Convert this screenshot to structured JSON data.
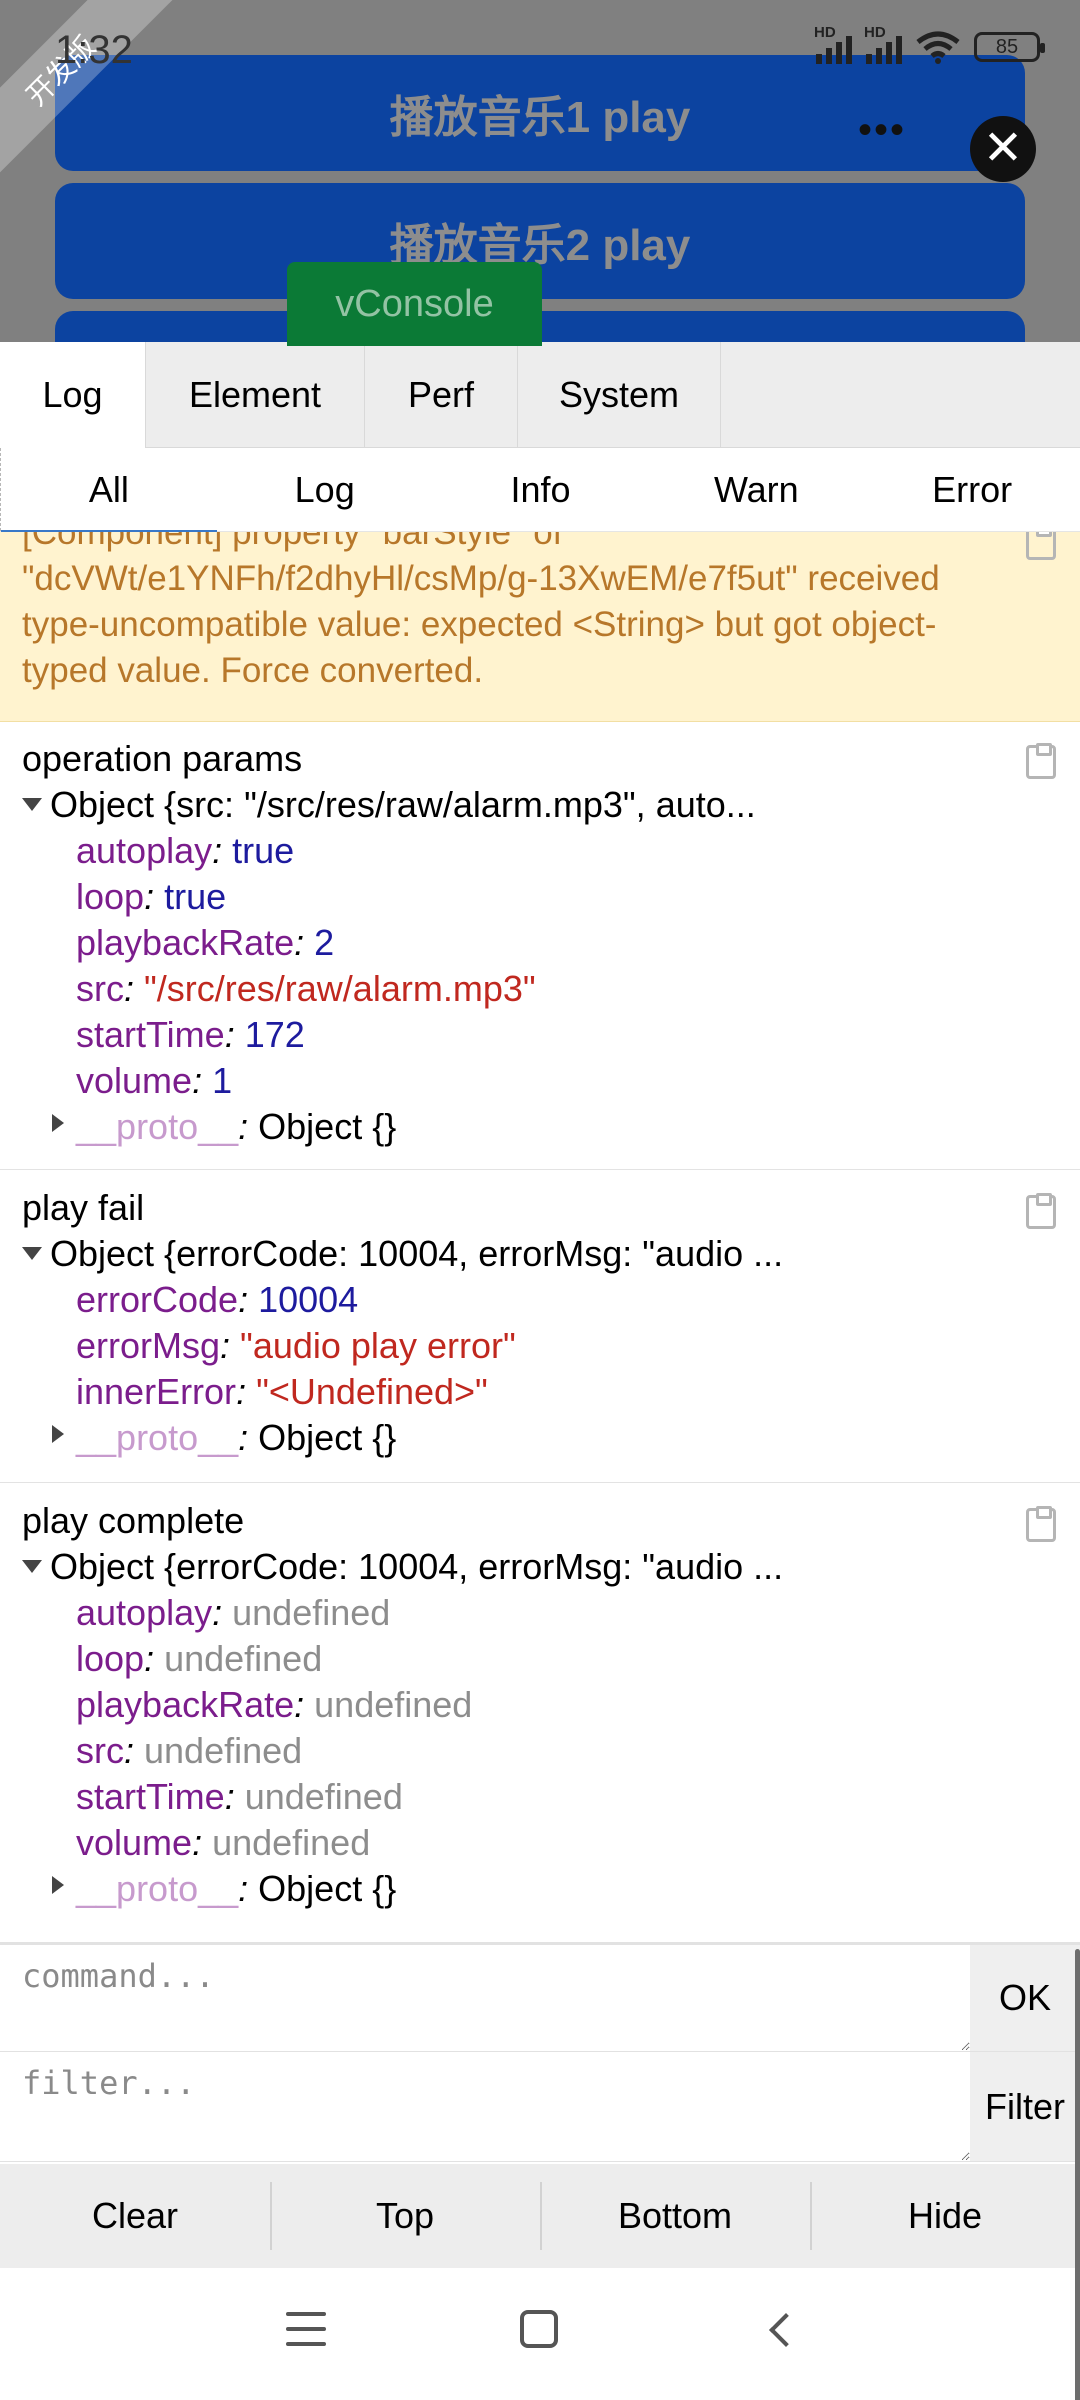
{
  "status_bar": {
    "time": "1:32",
    "signal_1_label": "HD",
    "signal_2_label": "HD",
    "battery": "85",
    "dev_ribbon": "开发版"
  },
  "app": {
    "button_1": "播放音乐1 play",
    "button_2": "播放音乐2 play"
  },
  "vconsole_button": "vConsole",
  "tabs": [
    "Log",
    "Element",
    "Perf",
    "System"
  ],
  "sub_tabs": [
    "All",
    "Log",
    "Info",
    "Warn",
    "Error"
  ],
  "logs": {
    "warning": "[Component] property \"barStyle\" of\n\"dcVWt/e1YNFh/f2dhyHl/csMp/g-13XwEM/e7f5ut\" received\ntype-uncompatible value: expected <String> but got object-\ntyped value. Force converted.",
    "entry1": {
      "title": "operation params",
      "summary": "Object {src: \"/src/res/raw/alarm.mp3\", auto...",
      "props": [
        {
          "key": "autoplay",
          "value": "true"
        },
        {
          "key": "loop",
          "value": "true"
        },
        {
          "key": "playbackRate",
          "value": "2"
        },
        {
          "key": "src",
          "value": "\"/src/res/raw/alarm.mp3\""
        },
        {
          "key": "startTime",
          "value": "172"
        },
        {
          "key": "volume",
          "value": "1"
        }
      ],
      "proto_key": "__proto__",
      "proto_value": "Object {}"
    },
    "entry2": {
      "title": "play fail",
      "summary": "Object {errorCode: 10004, errorMsg: \"audio ...",
      "props": [
        {
          "key": "errorCode",
          "value": "10004"
        },
        {
          "key": "errorMsg",
          "value": "\"audio play error\""
        },
        {
          "key": "innerError",
          "value": "\"<Undefined>\""
        }
      ],
      "proto_key": "__proto__",
      "proto_value": "Object {}"
    },
    "entry3": {
      "title": "play complete",
      "summary": "Object {errorCode: 10004, errorMsg: \"audio ...",
      "props": [
        {
          "key": "autoplay",
          "value": "undefined"
        },
        {
          "key": "loop",
          "value": "undefined"
        },
        {
          "key": "playbackRate",
          "value": "undefined"
        },
        {
          "key": "src",
          "value": "undefined"
        },
        {
          "key": "startTime",
          "value": "undefined"
        },
        {
          "key": "volume",
          "value": "undefined"
        }
      ],
      "proto_key": "__proto__",
      "proto_value": "Object {}"
    }
  },
  "command": {
    "placeholder": "command...",
    "button": "OK"
  },
  "filter": {
    "placeholder": "filter...",
    "button": "Filter"
  },
  "bottom_buttons": [
    "Clear",
    "Top",
    "Bottom",
    "Hide"
  ],
  "colors": {
    "app_button": "#0c43a0",
    "vconsole_green": "#0b7a36",
    "warning_bg": "#fff3cf",
    "warning_text": "#b7772a",
    "key_purple": "#7b1d8c",
    "number_blue": "#1d1b9e",
    "string_red": "#c0281f",
    "undefined_gray": "#8d8d8d"
  }
}
